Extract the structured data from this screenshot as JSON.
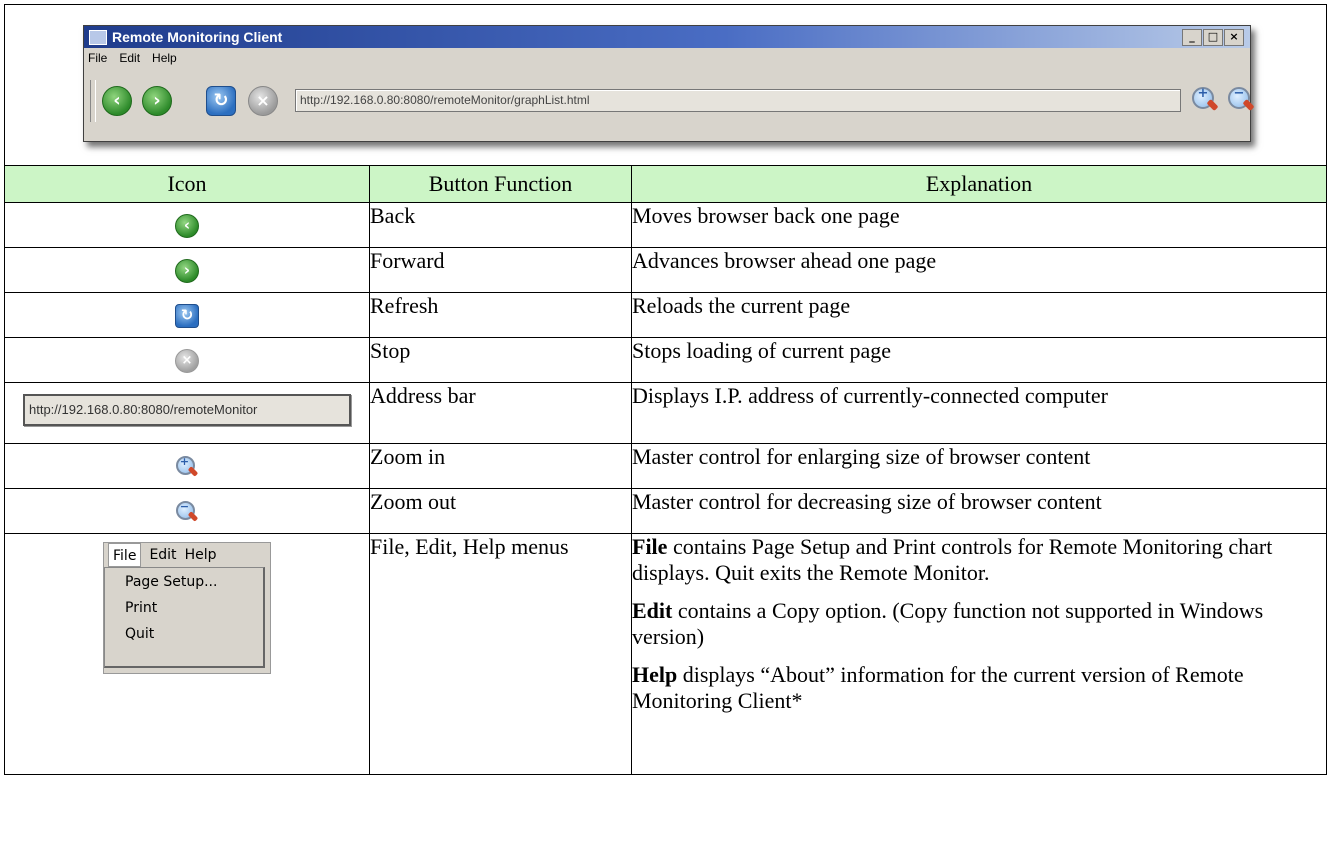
{
  "window": {
    "title": "Remote Monitoring Client",
    "controls": [
      "_",
      "□",
      "×"
    ],
    "menubar": [
      "File",
      "Edit",
      "Help"
    ],
    "url": "http://192.168.0.80:8080/remoteMonitor/graphList.html",
    "icons": [
      "back-icon",
      "forward-icon",
      "refresh-icon",
      "stop-icon",
      "zoom-in-icon",
      "zoom-out-icon"
    ]
  },
  "table": {
    "headers": [
      "Icon",
      "Button Function",
      "Explanation"
    ],
    "rows": [
      {
        "function": "Back",
        "explanation": "Moves browser back one page"
      },
      {
        "function": "Forward",
        "explanation": "Advances browser ahead one page"
      },
      {
        "function": "Refresh",
        "explanation": "Reloads the current page"
      },
      {
        "function": "Stop",
        "explanation": "Stops loading of current page"
      },
      {
        "function": "Address bar",
        "explanation": "Displays I.P. address of currently-connected computer",
        "icon_text": "http://192.168.0.80:8080/remoteMonitor"
      },
      {
        "function": "Zoom in",
        "explanation": "Master control for enlarging size of browser content"
      },
      {
        "function": "Zoom out",
        "explanation": "Master control for decreasing size of browser content"
      },
      {
        "function": "File, Edit, Help menus",
        "menu_bar": [
          "File",
          "Edit",
          "Help"
        ],
        "menu_items": [
          "Page Setup...",
          "Print",
          "Quit"
        ],
        "paragraphs": [
          {
            "bold": "File",
            "text": " contains Page Setup and Print controls for Remote Monitoring chart displays. Quit exits the Remote Monitor."
          },
          {
            "bold": "Edit",
            "text": " contains a Copy option. (Copy function not supported in Windows version)"
          },
          {
            "bold": "Help",
            "text": " displays “About” information for the current version of Remote Monitoring Client*"
          }
        ]
      }
    ]
  }
}
